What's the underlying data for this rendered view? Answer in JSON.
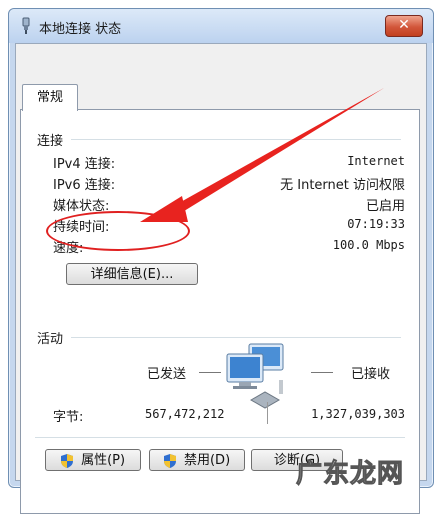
{
  "window": {
    "title": "本地连接 状态",
    "close_label": "✕"
  },
  "tab": {
    "label": "常规"
  },
  "connection": {
    "header": "连接",
    "rows": [
      {
        "label": "IPv4 连接:",
        "value": "Internet"
      },
      {
        "label": "IPv6 连接:",
        "value": "无 Internet 访问权限"
      },
      {
        "label": "媒体状态:",
        "value": "已启用"
      },
      {
        "label": "持续时间:",
        "value": "07:19:33"
      },
      {
        "label": "速度:",
        "value": "100.0 Mbps"
      }
    ],
    "details_button": "详细信息(E)..."
  },
  "activity": {
    "header": "活动",
    "sent_label": "已发送",
    "received_label": "已接收",
    "bytes_label": "字节:",
    "bytes_sent": "567,472,212",
    "bytes_received": "1,327,039,303"
  },
  "buttons": {
    "properties": "属性(P)",
    "disable": "禁用(D)",
    "diagnose": "诊断(G)"
  },
  "watermark": "广东龙网",
  "colors": {
    "annotation_red": "#e02020",
    "title_bar": "#c5d7ee"
  }
}
